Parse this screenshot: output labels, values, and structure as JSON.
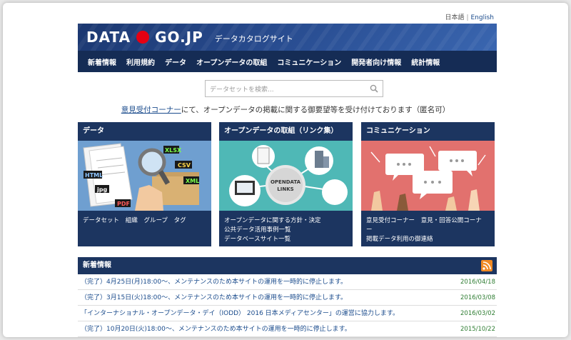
{
  "lang": {
    "ja": "日本語",
    "en": "English"
  },
  "logo": {
    "part1": "DATA",
    "part2": "GO.JP",
    "subtitle": "データカタログサイト"
  },
  "nav": [
    "新着情報",
    "利用規約",
    "データ",
    "オープンデータの取組",
    "コミュニケーション",
    "開発者向け情報",
    "統計情報"
  ],
  "search": {
    "placeholder": "データセットを検索..."
  },
  "notice": {
    "link": "意見受付コーナー",
    "text": "にて、オープンデータの掲載に関する御要望等を受け付けております（匿名可）"
  },
  "cards": [
    {
      "title": "データ",
      "links": [
        "データセット",
        "組織",
        "グループ",
        "タグ"
      ],
      "badges": [
        "XLSX",
        "CSV",
        "XML",
        "HTML",
        "jpg",
        "PDF"
      ]
    },
    {
      "title": "オープンデータの取組（リンク集）",
      "links": [
        "オープンデータに関する方針・決定",
        "公共データ活用事例一覧",
        "データベースサイト一覧"
      ],
      "badge_text": "OPENDATA LINKS"
    },
    {
      "title": "コミュニケーション",
      "links": [
        "意見受付コーナー",
        "意見・回答公開コーナー",
        "掲載データ利用の御連絡"
      ]
    }
  ],
  "news": {
    "title": "新着情報",
    "items": [
      {
        "text": "（完了）4月25日(月)18:00～、メンテナンスのため本サイトの運用を一時的に停止します。",
        "date": "2016/04/18"
      },
      {
        "text": "（完了）3月15日(火)18:00～、メンテナンスのため本サイトの運用を一時的に停止します。",
        "date": "2016/03/08"
      },
      {
        "text": "「インターナショナル・オープンデータ・デイ（IODD） 2016 日本メディアセンター」の運営に協力します。",
        "date": "2016/03/02"
      },
      {
        "text": "（完了）10月20日(火)18:00～、メンテナンスのため本サイトの運用を一時的に停止します。",
        "date": "2015/10/22"
      }
    ]
  },
  "colors": {
    "header": "#1e3a6e",
    "nav": "#152c55",
    "card": "#1c3560",
    "logo_dot": "#e60012",
    "date": "#2e7d32"
  }
}
